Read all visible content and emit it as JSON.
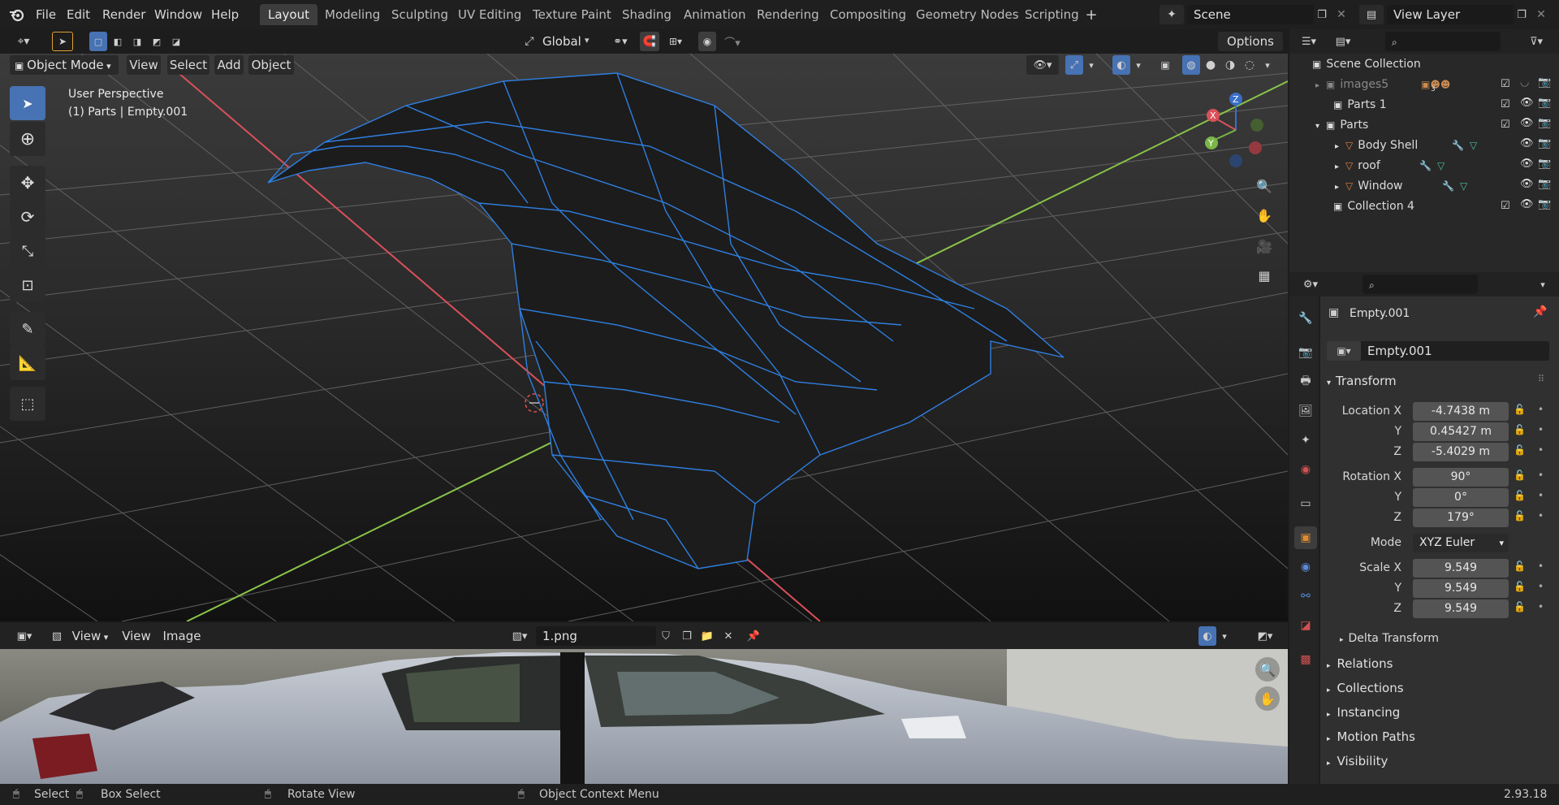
{
  "topbar": {
    "menus": [
      "File",
      "Edit",
      "Render",
      "Window",
      "Help"
    ],
    "workspaces": [
      "Layout",
      "Modeling",
      "Sculpting",
      "UV Editing",
      "Texture Paint",
      "Shading",
      "Animation",
      "Rendering",
      "Compositing",
      "Geometry Nodes",
      "Scripting"
    ],
    "active_workspace": "Layout",
    "scene": "Scene",
    "view_layer": "View Layer"
  },
  "tool_header": {
    "orientation": "Global",
    "options": "Options"
  },
  "viewport_header": {
    "mode": "Object Mode",
    "menus": [
      "View",
      "Select",
      "Add",
      "Object"
    ]
  },
  "viewport": {
    "perspective": "User Perspective",
    "context": "(1) Parts | Empty.001",
    "gizmo": {
      "x": "X",
      "y": "Y",
      "z": "Z"
    }
  },
  "outliner": {
    "rows": [
      {
        "label": "Scene Collection"
      },
      {
        "label": "images5",
        "badge": "3"
      },
      {
        "label": "Parts 1"
      },
      {
        "label": "Parts"
      },
      {
        "label": "Body Shell"
      },
      {
        "label": "roof"
      },
      {
        "label": "Window"
      },
      {
        "label": "Collection 4"
      }
    ]
  },
  "properties": {
    "object_name": "Empty.001",
    "data_name": "Empty.001",
    "transform_label": "Transform",
    "location_label": "Location X",
    "rotation_label": "Rotation X",
    "scale_label": "Scale X",
    "axis_y": "Y",
    "axis_z": "Z",
    "location": [
      "-4.7438 m",
      "0.45427 m",
      "-5.4029 m"
    ],
    "rotation": [
      "90°",
      "0°",
      "179°"
    ],
    "mode_label": "Mode",
    "mode_value": "XYZ Euler",
    "scale": [
      "9.549",
      "9.549",
      "9.549"
    ],
    "subpanels": [
      "Delta Transform",
      "Relations",
      "Collections",
      "Instancing",
      "Motion Paths",
      "Visibility"
    ]
  },
  "image_editor": {
    "menus": [
      "View",
      "View",
      "Image"
    ],
    "image_name": "1.png"
  },
  "statusbar": {
    "select": "Select",
    "box_select": "Box Select",
    "rotate_view": "Rotate View",
    "context_menu": "Object Context Menu",
    "version": "2.93.18"
  },
  "colors": {
    "accent": "#4772b3",
    "wire": "#2f7fe0",
    "x_axis": "#d9505a",
    "y_axis": "#8bc34a"
  }
}
